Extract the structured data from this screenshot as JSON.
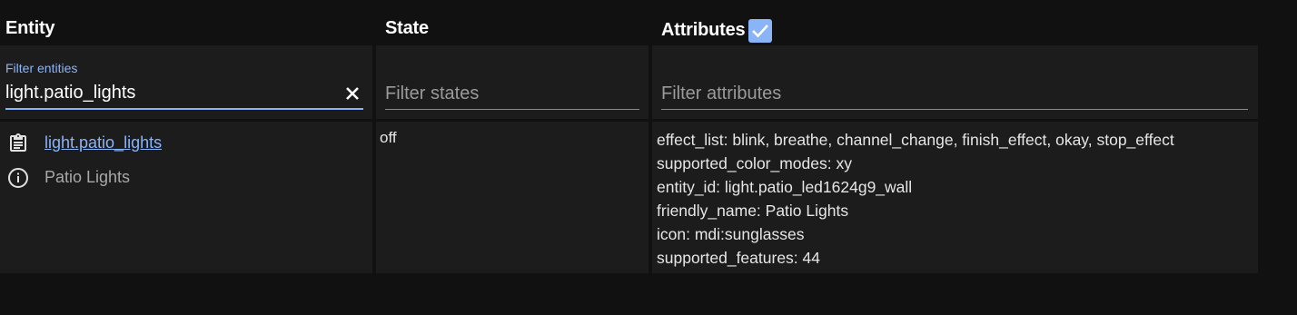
{
  "headers": {
    "entity": "Entity",
    "state": "State",
    "attributes": "Attributes"
  },
  "attributes_checkbox": {
    "checked": true,
    "color": "#8ab4f8"
  },
  "filters": {
    "entity": {
      "label": "Filter entities",
      "value": "light.patio_lights"
    },
    "state": {
      "placeholder": "Filter states"
    },
    "attributes": {
      "placeholder": "Filter attributes"
    }
  },
  "row": {
    "entity_id": "light.patio_lights",
    "friendly_name": "Patio Lights",
    "state": "off",
    "attributes": [
      "effect_list: blink, breathe, channel_change, finish_effect, okay, stop_effect",
      "supported_color_modes: xy",
      "entity_id: light.patio_led1624g9_wall",
      "friendly_name: Patio Lights",
      "icon: mdi:sunglasses",
      "supported_features: 44"
    ]
  },
  "icons": {
    "clear": "close-icon",
    "copy": "clipboard-icon",
    "info": "info-circle-icon",
    "check": "check-icon"
  },
  "colors": {
    "accent": "#8ab4f8",
    "background": "#111111",
    "cell": "#1c1c1c"
  }
}
